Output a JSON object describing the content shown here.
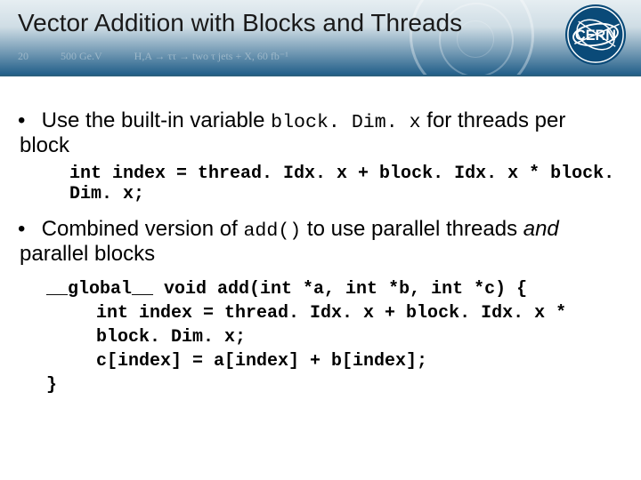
{
  "title": "Vector Addition with Blocks and Threads",
  "logo_name": "cern-logo",
  "header_deco": {
    "left_numbers": "20",
    "mass_label": "500 Ge.V",
    "formula": "H,A → ττ → two τ jets + X, 60 fb⁻¹"
  },
  "bullet1": {
    "pre": "Use the built-in variable ",
    "code": "block. Dim. x",
    "post": " for threads per block"
  },
  "bullet1_code": "int index = thread. Idx. x + block. Idx. x * block. Dim. x;",
  "bullet2": {
    "pre": "Combined version of ",
    "code": "add()",
    "mid": " to use parallel threads ",
    "em": "and",
    "post": " parallel blocks"
  },
  "code": {
    "l1": "__global__ void add(int *a, int *b, int *c) {",
    "l2": "int index = thread. Idx. x + block. Idx. x * block. Dim. x;",
    "l3": "c[index] = a[index] + b[index];",
    "l4": "}"
  }
}
